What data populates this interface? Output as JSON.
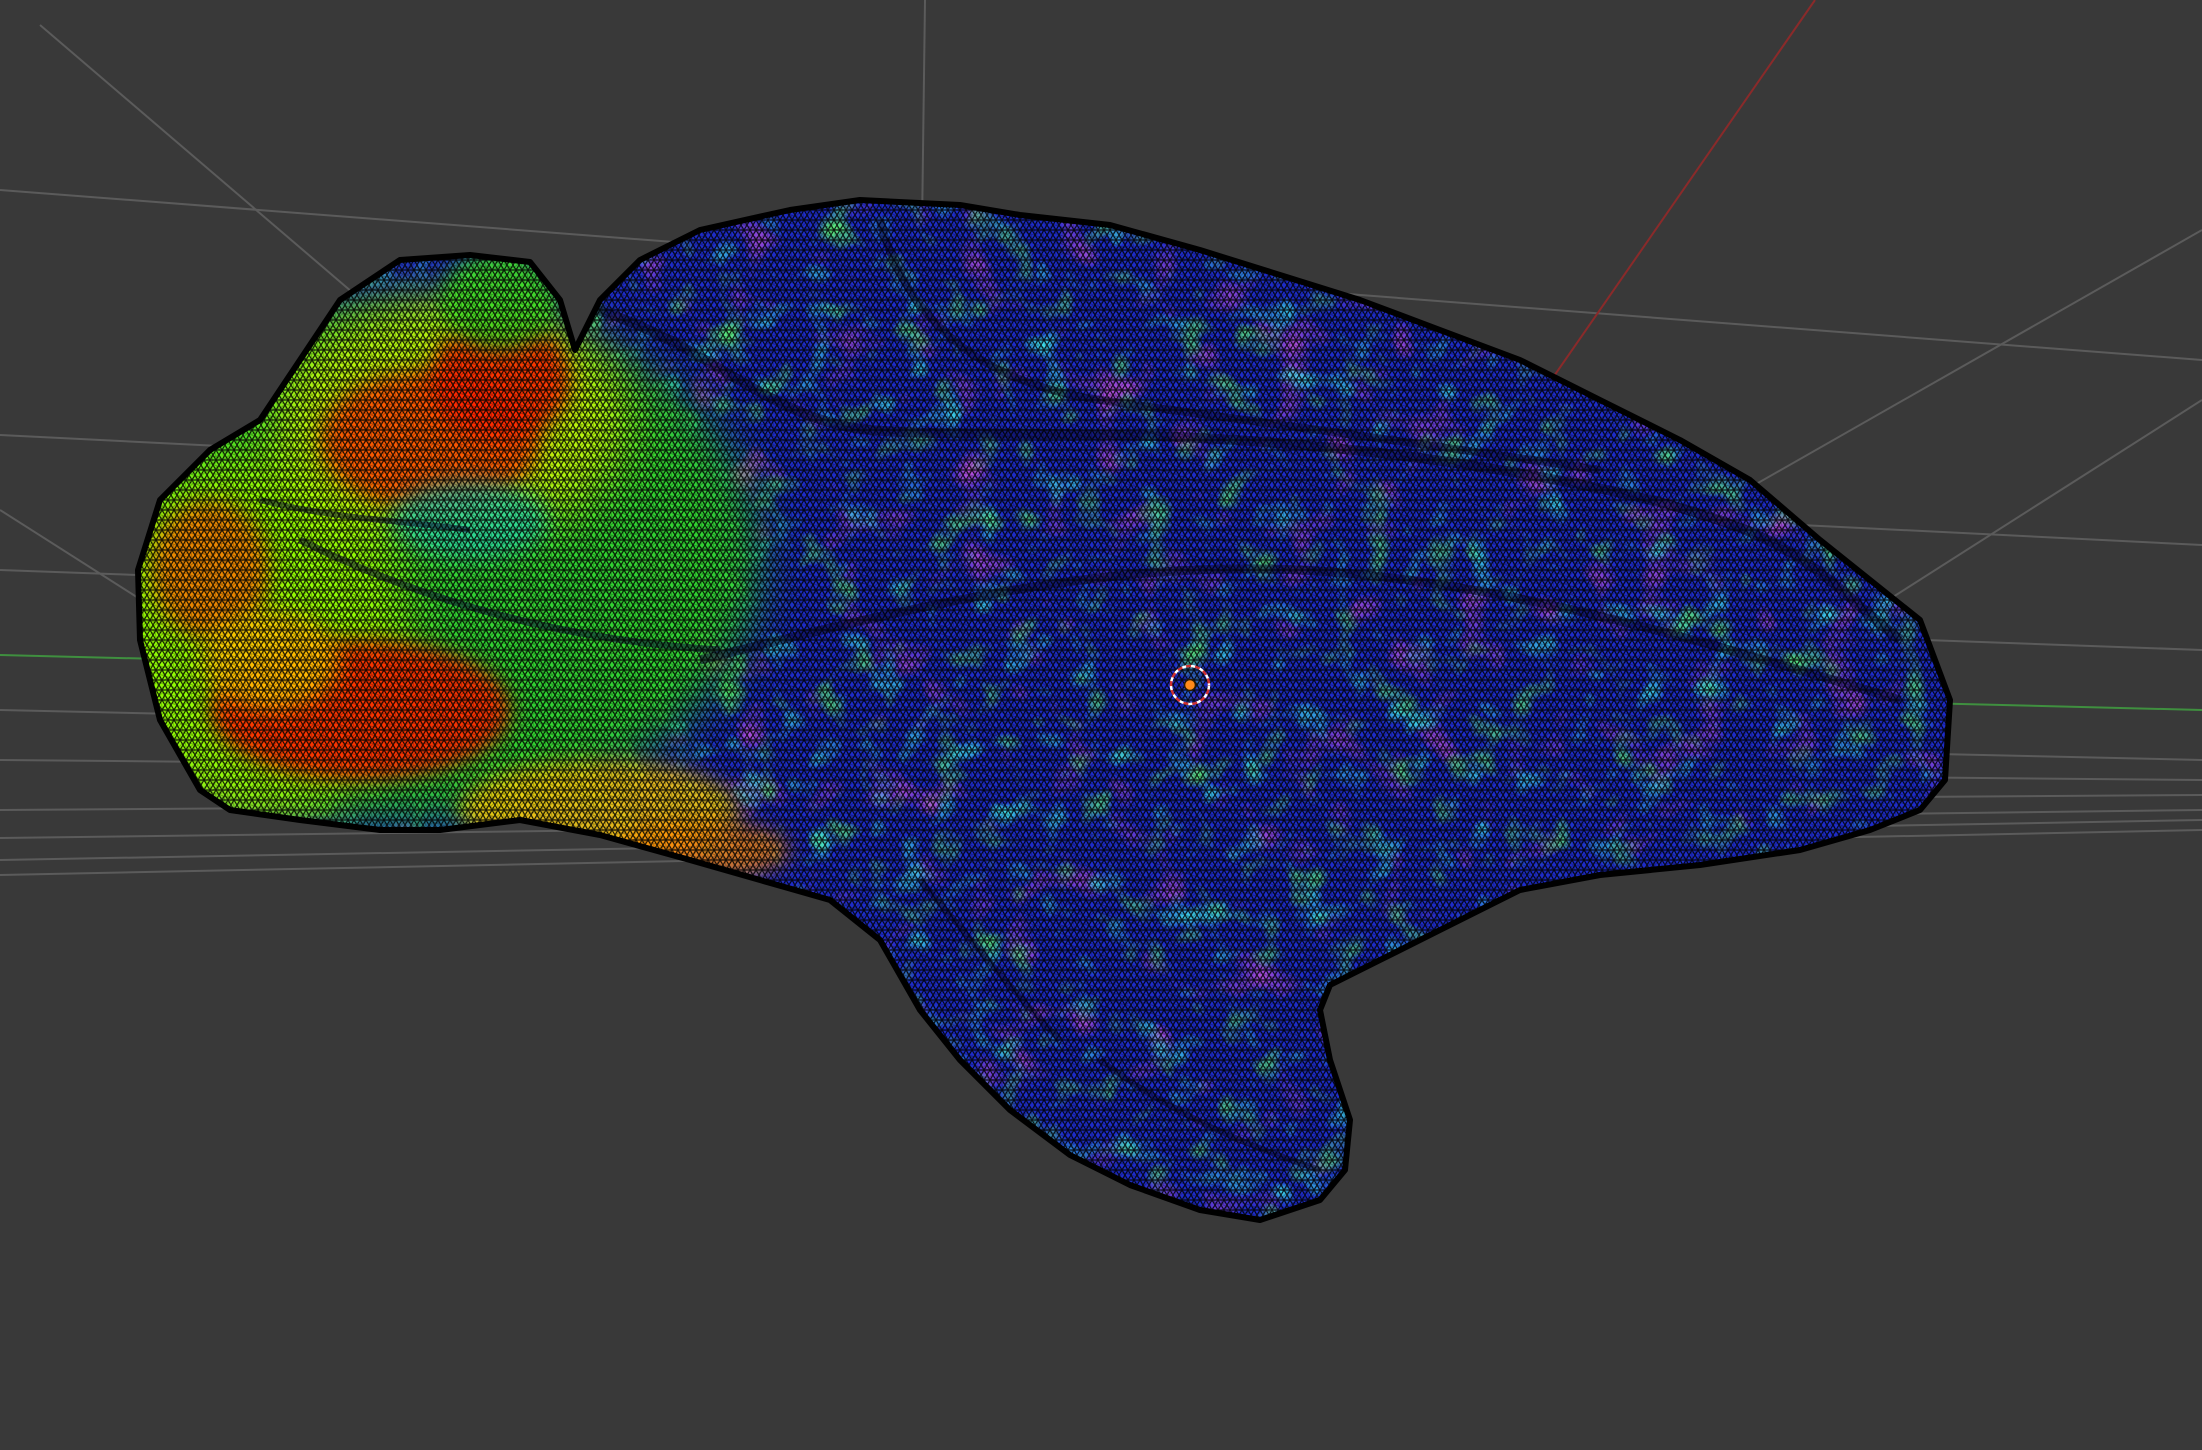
{
  "viewport": {
    "background": "#393939",
    "grid_color": "#5a5a5a",
    "x_axis_color": "#8a2a2a",
    "y_axis_color": "#3f8f3f"
  },
  "object": {
    "kind": "brain-surface-mesh",
    "shading": "vertex-color-heatmap",
    "wireframe": true,
    "colormap": [
      "#ff1e00",
      "#ffb000",
      "#f2ff00",
      "#6cff00",
      "#00d94a",
      "#00c6c6",
      "#1a3cff",
      "#2a10c8",
      "#7a1ab8"
    ]
  },
  "overlay": {
    "origin_icon": "origin-dot-icon",
    "cursor_icon": "3d-cursor-icon"
  }
}
